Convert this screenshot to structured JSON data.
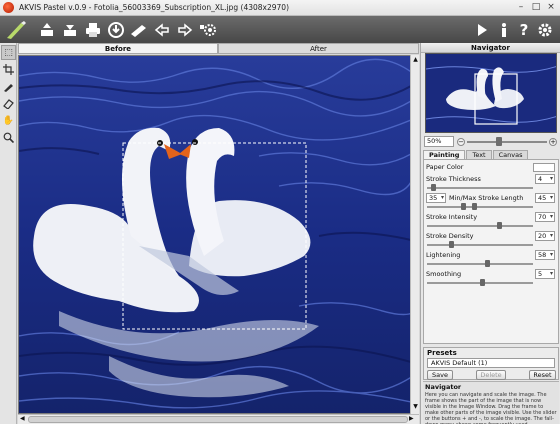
{
  "window": {
    "title": "AKVIS Pastel v.0.9 - Fotolia_56003369_Subscription_XL.jpg (4308x2970)"
  },
  "toolbar": {
    "left_icons": [
      "open-icon",
      "save-icon",
      "print-icon",
      "share-icon",
      "preferences-icon",
      "undo-icon",
      "redo-icon",
      "batch-icon"
    ],
    "right_icons": [
      "run-icon",
      "info-icon",
      "help-icon",
      "settings-icon"
    ]
  },
  "view_tabs": {
    "before": "Before",
    "after": "After"
  },
  "navigator": {
    "title": "Navigator",
    "zoom": "50%",
    "zoom_fraction": 0.75
  },
  "settings_tabs": [
    "Painting",
    "Text",
    "Canvas"
  ],
  "params": {
    "paper_color": "Paper Color",
    "stroke_thickness": {
      "label": "Stroke Thickness",
      "value": "4"
    },
    "min_stroke": "35",
    "max_stroke": {
      "label": "Min/Max Stroke Length",
      "value": "45"
    },
    "stroke_intensity": {
      "label": "Stroke Intensity",
      "value": "70"
    },
    "stroke_density": {
      "label": "Stroke Density",
      "value": "20"
    },
    "lightening": {
      "label": "Lightening",
      "value": "58"
    },
    "smoothing": {
      "label": "Smoothing",
      "value": "5"
    }
  },
  "presets": {
    "title": "Presets",
    "selected": "AKVIS Default (1)",
    "save": "Save",
    "delete": "Delete",
    "reset": "Reset"
  },
  "help": {
    "title": "Navigator",
    "text": "Here you can navigate and scale the image. The frame shows the part of the image that is now visible in the Image Window. Drag the frame to make other parts of the image visible. Use the slider or the buttons + and -, to scale the image. The fall-down menu shows some frequently used coefficients."
  },
  "colors": {
    "toolbar": "#555555",
    "water": "#1d2f84"
  }
}
